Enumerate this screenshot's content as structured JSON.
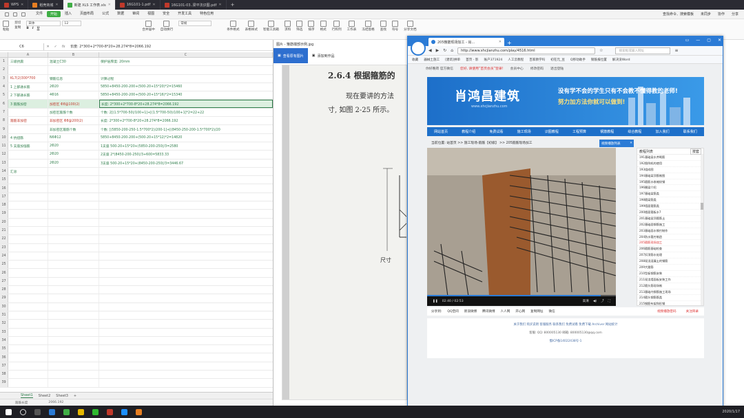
{
  "wps_tabs": [
    {
      "label": "WPS",
      "icon": "wps-icon",
      "color": "#c0392b"
    },
    {
      "label": "稻壳商城",
      "icon": "daoke-icon",
      "color": "#e67e22"
    },
    {
      "label": "新建 XLS 工作表.xls",
      "icon": "sheet-icon",
      "color": "#3fae45"
    },
    {
      "label": "16G101-1.pdf",
      "icon": "pdf-icon",
      "color": "#c0392b"
    },
    {
      "label": "16G101-03..梁平法识图.pdf",
      "icon": "pdf-icon",
      "color": "#c0392b"
    }
  ],
  "wps_menu": [
    "文件",
    "开始",
    "插入",
    "页面布局",
    "公式",
    "数据",
    "审阅",
    "视图",
    "安全",
    "开发工具",
    "特色应用"
  ],
  "wps_menu_right": [
    "查找命令、搜索模板",
    "未同步",
    "协作",
    "分享"
  ],
  "ribbon": {
    "paste": "粘贴",
    "cut": "剪切",
    "copy": "复制",
    "format_painter": "格式刷",
    "font_name": "宋体",
    "font_size": "12",
    "merge": "合并居中",
    "wrap": "自动换行",
    "number_format": "常规",
    "cond": "条件格式",
    "table_style": "表格样式",
    "sum": "求和",
    "filter": "筛选",
    "sort": "排序",
    "format": "格式",
    "rowcol": "行和列",
    "worksheet": "工作表",
    "freeze": "冻结窗格",
    "find": "查找",
    "symbol": "符号",
    "share_doc": "分享文档",
    "smart": "智能工具箱"
  },
  "formula": {
    "cell": "C6",
    "content": "长度: 2*300+2*700-8*20+28.274*8=2066.192"
  },
  "columns": [
    "A",
    "B",
    "C"
  ],
  "rows": [
    {
      "n": "1",
      "a": "三级抗震",
      "b": "混凝土C30",
      "c": "保护层厚度: 20mm"
    },
    {
      "n": "2",
      "a": "",
      "b": "",
      "c": ""
    },
    {
      "n": "3",
      "a": "KL7(2)300*700",
      "b": "钢筋信息",
      "c": "计算过程"
    },
    {
      "n": "4",
      "a": "1 上部通长筋",
      "b": "2Φ20",
      "c": "5850+8450-200-200+(500-20+15*20)*2=15460"
    },
    {
      "n": "5",
      "a": "2 下部通长筋",
      "b": "4Φ16",
      "c": "5850+8450-200-200+(500-20+15*16)*2=15340"
    },
    {
      "n": "6",
      "a": "3 箍筋加密",
      "b": "加密区 Φ8@100(2)",
      "c": "长度: 2*300+2*700-8*20+28.274*8=2066.192"
    },
    {
      "n": "7",
      "a": "",
      "b": "加密区箍筋个数",
      "c": "个数: 2[(1.5*700-50)/100+1]+[(1.5*700-50)/100+1]*2=22+22"
    },
    {
      "n": "8",
      "a": "箍筋非加密",
      "b": "非加密区 Φ8@200(2)",
      "c": "长度: 2*300+2*700-8*20+28.274*8=2066.192"
    },
    {
      "n": "9",
      "a": "",
      "b": "非加密区箍筋个数",
      "c": "个数: [(5850-200-250-1.5*700*2)/200-1]+[(8450-250-200-1.5*700*2)/20"
    },
    {
      "n": "10",
      "a": "4 抗扭筋",
      "b": "N6Φ12",
      "c": "5850+8450-200-200+(500-20+15*12)*2=14820"
    },
    {
      "n": "11",
      "a": "5 支座加强筋",
      "b": "2Φ20",
      "c": "1支座 500-20+15*20+(5850-200-250)/3=2580"
    },
    {
      "n": "12",
      "a": "",
      "b": "2Φ20",
      "c": "2支座 2*(8450-200-250)/3+600=5833.33"
    },
    {
      "n": "13",
      "a": "",
      "b": "2Φ20",
      "c": "3支座 500-20+15*20+(8450-200-250)/3=3446.67"
    },
    {
      "n": "14",
      "a": "汇总",
      "b": "",
      "c": ""
    },
    {
      "n": "15",
      "a": "",
      "b": "",
      "c": ""
    },
    {
      "n": "16",
      "a": "",
      "b": "",
      "c": ""
    },
    {
      "n": "17",
      "a": "",
      "b": "",
      "c": ""
    },
    {
      "n": "18",
      "a": "",
      "b": "",
      "c": ""
    },
    {
      "n": "19",
      "a": "",
      "b": "",
      "c": ""
    },
    {
      "n": "20",
      "a": "",
      "b": "",
      "c": ""
    },
    {
      "n": "21",
      "a": "",
      "b": "",
      "c": ""
    },
    {
      "n": "22",
      "a": "",
      "b": "",
      "c": ""
    },
    {
      "n": "23",
      "a": "",
      "b": "",
      "c": ""
    },
    {
      "n": "24",
      "a": "",
      "b": "",
      "c": ""
    },
    {
      "n": "25",
      "a": "",
      "b": "",
      "c": ""
    },
    {
      "n": "26",
      "a": "",
      "b": "",
      "c": ""
    },
    {
      "n": "27",
      "a": "",
      "b": "",
      "c": ""
    },
    {
      "n": "28",
      "a": "",
      "b": "",
      "c": ""
    },
    {
      "n": "29",
      "a": "",
      "b": "",
      "c": ""
    },
    {
      "n": "30",
      "a": "",
      "b": "",
      "c": ""
    },
    {
      "n": "31",
      "a": "",
      "b": "",
      "c": ""
    },
    {
      "n": "32",
      "a": "",
      "b": "",
      "c": ""
    },
    {
      "n": "33",
      "a": "",
      "b": "",
      "c": ""
    },
    {
      "n": "34",
      "a": "",
      "b": "",
      "c": ""
    },
    {
      "n": "35",
      "a": "",
      "b": "",
      "c": ""
    },
    {
      "n": "36",
      "a": "",
      "b": "",
      "c": ""
    },
    {
      "n": "37",
      "a": "",
      "b": "",
      "c": ""
    },
    {
      "n": "38",
      "a": "",
      "b": "",
      "c": ""
    },
    {
      "n": "39",
      "a": "",
      "b": "",
      "c": ""
    }
  ],
  "sheets": [
    "Sheet1",
    "Sheet2",
    "Sheet3"
  ],
  "status": {
    "left": "箍筋长度",
    "right": "2066.192"
  },
  "viewer": {
    "title": "图片 - 箍筋端部示例.jpg",
    "tabs": [
      "查看原有图片",
      "添加到作品"
    ],
    "page_title": "2.6.4 根据箍筋的",
    "page_line1": "现在要讲的方法",
    "page_line2": "寸, 如图 2-25 所示。",
    "label_bottom": "尺寸"
  },
  "browser": {
    "tab": "205箍筋现场加工 - 肖...",
    "url": "http://www.xhcjianzhu.com/play/4516.html",
    "search_placeholder": "搜索框或输入网址",
    "fav": [
      "收藏",
      "器械土施工",
      "[建筑]拼单",
      "首页 - 影",
      "账户371924",
      "人工云教程",
      "百家教学吗",
      "初在元_豆",
      "Q移动助手",
      "钢筋报位置",
      "解决没Word"
    ],
    "site": {
      "topline": [
        "你好晚荷 官方微信",
        "您好, 请使用“首页会员”登录!",
        "会员中心",
        "修改密码",
        "退出登陆"
      ],
      "brand": "肖鸿昌建筑",
      "brand_url": "www.xhcjianzhu.com",
      "slogan1": "没有学不会的学生只有不会教不懂得教的老师!",
      "slogan2": "努力加方法你就可以做到!",
      "nav": [
        "网站首页",
        "教程介绍",
        "免费试看",
        "施工现场",
        "识图教程",
        "工程预算",
        "钢筋教程",
        "综合教程",
        "加入我们",
        "联系我们"
      ],
      "crumb": "当前位置: 站首页 >> 施工现场-箍筋【初级】 >> 205箍筋现场加工",
      "popup": "视频播放列表",
      "list_head": "教程列表",
      "list_sort": "按套",
      "list": [
        "191基础梁水井砌筋",
        "192图例机的使用",
        "193组成图",
        "194基础梁顶筋制图",
        "195箍筋水收缩纹钢",
        "196圈梁介绍",
        "197基础梁筋类",
        "198箍梁筋类",
        "199墙面箍筋类",
        "200楼面箍板水7",
        "201基础梁顶箍筋土",
        "202基础面钢筋施工",
        "203基础面水钢刃制作",
        "204防水箍刃制造",
        "205箍筋现场加工",
        "206箍筋基础检查",
        "207扣顶筋水处理",
        "208现浇混凝土的钢筋",
        "209大跟筋",
        "210型板钢筋安装",
        "211现浇墙面板安装工作",
        "212箍头筋现场制",
        "213基础内钢筋施工现场",
        "214箍头钢筋筋类",
        "215钢筋布架和形钢",
        "216墙水井钢筋施工1",
        "217墙水井钢筋施工2",
        "218木方介绍",
        "219墙上钢筋介绍1"
      ],
      "video": {
        "time": "02:40 / 02:53",
        "quality": "高清",
        "progress": 0.92
      },
      "share": [
        "分享到:",
        "QQ空间",
        "新浪微博",
        "腾讯微博",
        "人人网",
        "开心网",
        "复制网址",
        "微信"
      ],
      "share_red": [
        "视频播放密码",
        "关注目录"
      ],
      "footer1": "关于我们 购买说明 客服服务 联系我们 免费试看 免费下载 Archiver 网站统计",
      "footer2": "客服: QQ: 800005130 邮箱: 800005130@qq.com",
      "footer3": "蜀ICP备14022438号-1"
    }
  },
  "taskbar": {
    "clock": "2020/1/17"
  }
}
